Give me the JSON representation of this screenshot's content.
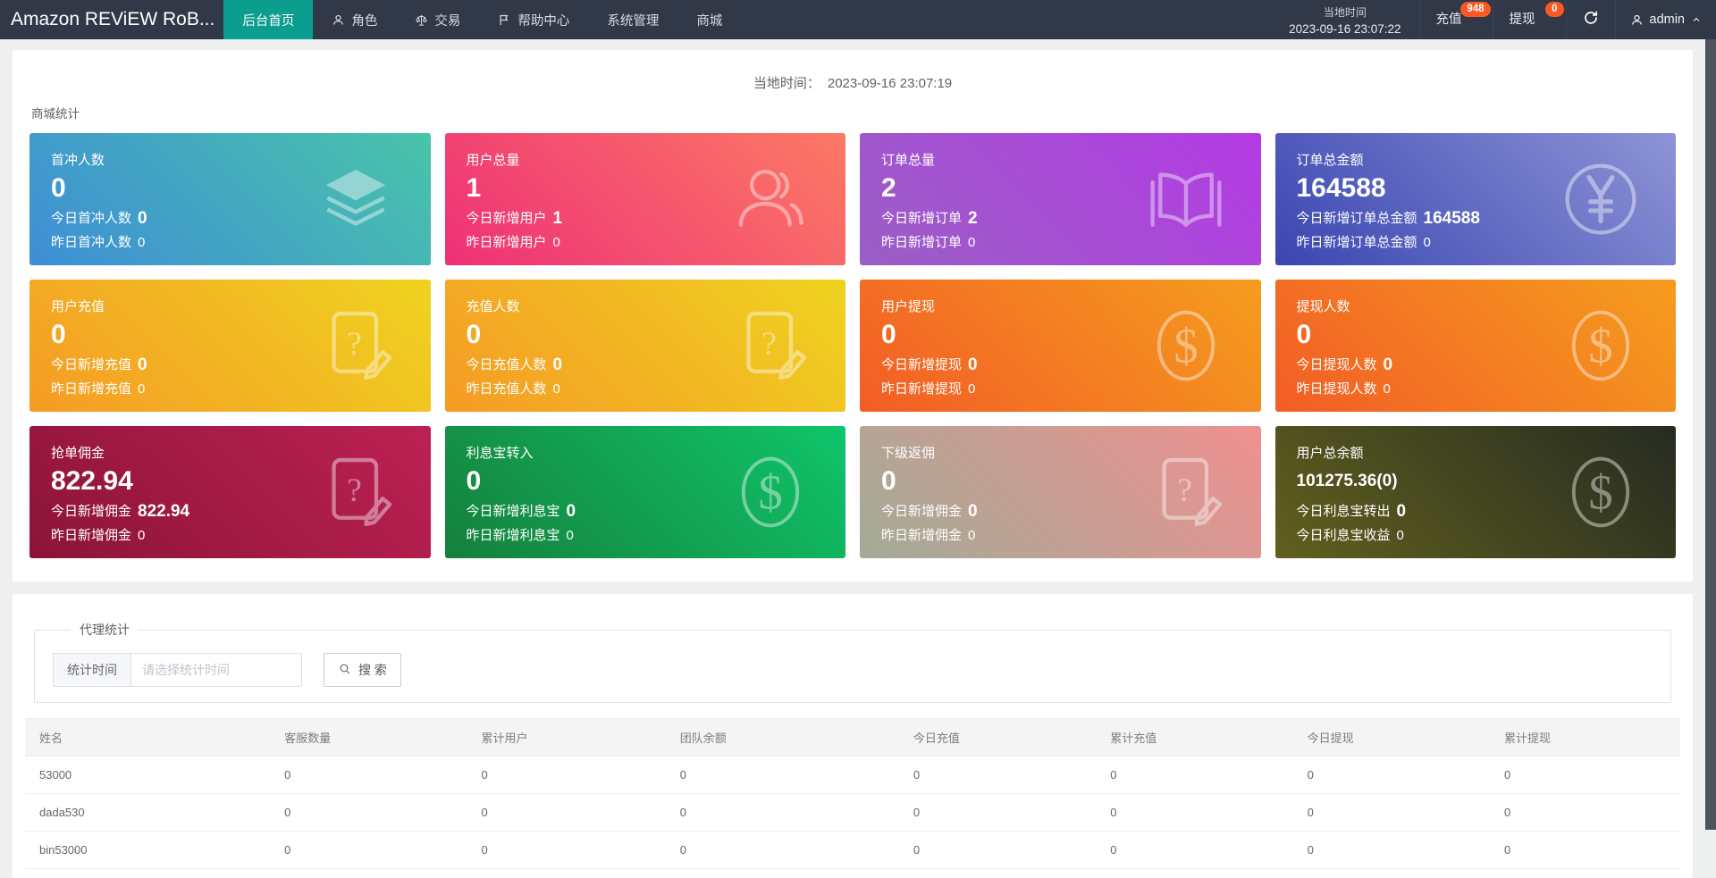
{
  "navbar": {
    "logo": "Amazon REViEW RoB...",
    "menu": [
      {
        "label": "后台首页",
        "icon": null,
        "active": true
      },
      {
        "label": "角色",
        "icon": "person",
        "active": false
      },
      {
        "label": "交易",
        "icon": "scales",
        "active": false
      },
      {
        "label": "帮助中心",
        "icon": "flag",
        "active": false
      },
      {
        "label": "系统管理",
        "icon": null,
        "active": false
      },
      {
        "label": "商城",
        "icon": null,
        "active": false
      }
    ],
    "local_time_label": "当地时间",
    "local_time_value": "2023-09-16 23:07:22",
    "links": [
      {
        "label": "充值",
        "badge": "948"
      },
      {
        "label": "提现",
        "badge": "0"
      }
    ],
    "username": "admin"
  },
  "colors": {
    "navbar_bg": "#313847",
    "active_menu_bg": "#0b9d8d",
    "badge_bg": "#ff5722",
    "page_bg": "#eef0f0"
  },
  "stats_panel": {
    "local_time_label": "当地时间：",
    "local_time_value": "2023-09-16 23:07:19",
    "section_title": "商城统计",
    "cards": [
      {
        "title": "首冲人数",
        "value": "0",
        "small_value": false,
        "line1_label": "今日首冲人数",
        "line1_value": "0",
        "line2_label": "昨日首冲人数",
        "line2_value": "0",
        "icon": "layers",
        "gradient": [
          "#3e8ed6",
          "#49c4a9"
        ]
      },
      {
        "title": "用户总量",
        "value": "1",
        "small_value": false,
        "line1_label": "今日新增用户",
        "line1_value": "1",
        "line2_label": "昨日新增用户",
        "line2_value": "0",
        "icon": "people",
        "gradient": [
          "#ee3077",
          "#fc7a64"
        ]
      },
      {
        "title": "订单总量",
        "value": "2",
        "small_value": false,
        "line1_label": "今日新增订单",
        "line1_value": "2",
        "line2_label": "昨日新增订单",
        "line2_value": "0",
        "icon": "book",
        "gradient": [
          "#9a5fc5",
          "#b43ae4"
        ]
      },
      {
        "title": "订单总金额",
        "value": "164588",
        "small_value": false,
        "line1_label": "今日新增订单总金额",
        "line1_value": "164588",
        "line2_label": "昨日新增订单总金额",
        "line2_value": "0",
        "icon": "yen-circle",
        "gradient": [
          "#3a46b1",
          "#8e94d6"
        ]
      },
      {
        "title": "用户充值",
        "value": "0",
        "small_value": false,
        "line1_label": "今日新增充值",
        "line1_value": "0",
        "line2_label": "昨日新增充值",
        "line2_value": "0",
        "icon": "file-edit",
        "gradient": [
          "#f59b25",
          "#efd320"
        ]
      },
      {
        "title": "充值人数",
        "value": "0",
        "small_value": false,
        "line1_label": "今日充值人数",
        "line1_value": "0",
        "line2_label": "昨日充值人数",
        "line2_value": "0",
        "icon": "file-edit",
        "gradient": [
          "#f59b25",
          "#efd320"
        ]
      },
      {
        "title": "用户提现",
        "value": "0",
        "small_value": false,
        "line1_label": "今日新增提现",
        "line1_value": "0",
        "line2_label": "昨日新增提现",
        "line2_value": "0",
        "icon": "dollar-circle",
        "gradient": [
          "#f25d26",
          "#f59d1d"
        ]
      },
      {
        "title": "提现人数",
        "value": "0",
        "small_value": false,
        "line1_label": "今日提现人数",
        "line1_value": "0",
        "line2_label": "昨日提现人数",
        "line2_value": "0",
        "icon": "dollar-circle",
        "gradient": [
          "#f25d26",
          "#f59d1d"
        ]
      },
      {
        "title": "抢单佣金",
        "value": "822.94",
        "small_value": false,
        "line1_label": "今日新增佣金",
        "line1_value": "822.94",
        "line2_label": "昨日新增佣金",
        "line2_value": "0",
        "icon": "file-edit",
        "gradient": [
          "#8c1438",
          "#bd2154"
        ]
      },
      {
        "title": "利息宝转入",
        "value": "0",
        "small_value": false,
        "line1_label": "今日新增利息宝",
        "line1_value": "0",
        "line2_label": "昨日新增利息宝",
        "line2_value": "0",
        "icon": "dollar-circle",
        "gradient": [
          "#15803c",
          "#0fc56a"
        ]
      },
      {
        "title": "下级返佣",
        "value": "0",
        "small_value": false,
        "line1_label": "今日新增佣金",
        "line1_value": "0",
        "line2_label": "昨日新增佣金",
        "line2_value": "0",
        "icon": "file-edit",
        "gradient": [
          "#a2ab97",
          "#f09090"
        ]
      },
      {
        "title": "用户总余额",
        "value": "101275.36(0)",
        "small_value": true,
        "line1_label": "今日利息宝转出",
        "line1_value": "0",
        "line2_label": "今日利息宝收益",
        "line2_value": "0",
        "icon": "dollar-circle",
        "gradient": [
          "#61601e",
          "#262b21"
        ]
      }
    ]
  },
  "agent_panel": {
    "legend": "代理统计",
    "filter_label": "统计时间",
    "filter_placeholder": "请选择统计时间",
    "search_label": "搜 索",
    "table": {
      "headers": [
        "姓名",
        "客服数量",
        "累计用户",
        "团队余额",
        "今日充值",
        "累计充值",
        "今日提现",
        "累计提现"
      ],
      "rows": [
        [
          "53000",
          "0",
          "0",
          "0",
          "0",
          "0",
          "0",
          "0"
        ],
        [
          "dada530",
          "0",
          "0",
          "0",
          "0",
          "0",
          "0",
          "0"
        ],
        [
          "bin53000",
          "0",
          "0",
          "0",
          "0",
          "0",
          "0",
          "0"
        ]
      ]
    }
  }
}
